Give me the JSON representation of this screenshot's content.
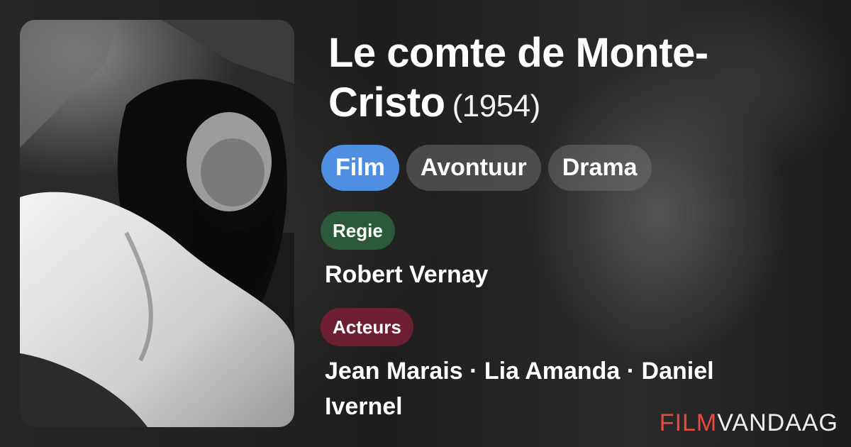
{
  "movie": {
    "title": "Le comte de Monte-Cristo",
    "year": "(1954)"
  },
  "genres": [
    "Film",
    "Avontuur",
    "Drama"
  ],
  "director": {
    "label": "Regie",
    "names": "Robert Vernay"
  },
  "cast": {
    "label": "Acteurs",
    "names": "Jean Marais · Lia Amanda · Daniel Ivernel"
  },
  "brand": {
    "part1": "FILM",
    "part2": "VANDAAG",
    "accent_color": "#e84a3d"
  },
  "colors": {
    "genre_primary": "#4f8fe2",
    "regie_badge": "#2a5a3b",
    "acteurs_badge": "#6e1f33"
  }
}
